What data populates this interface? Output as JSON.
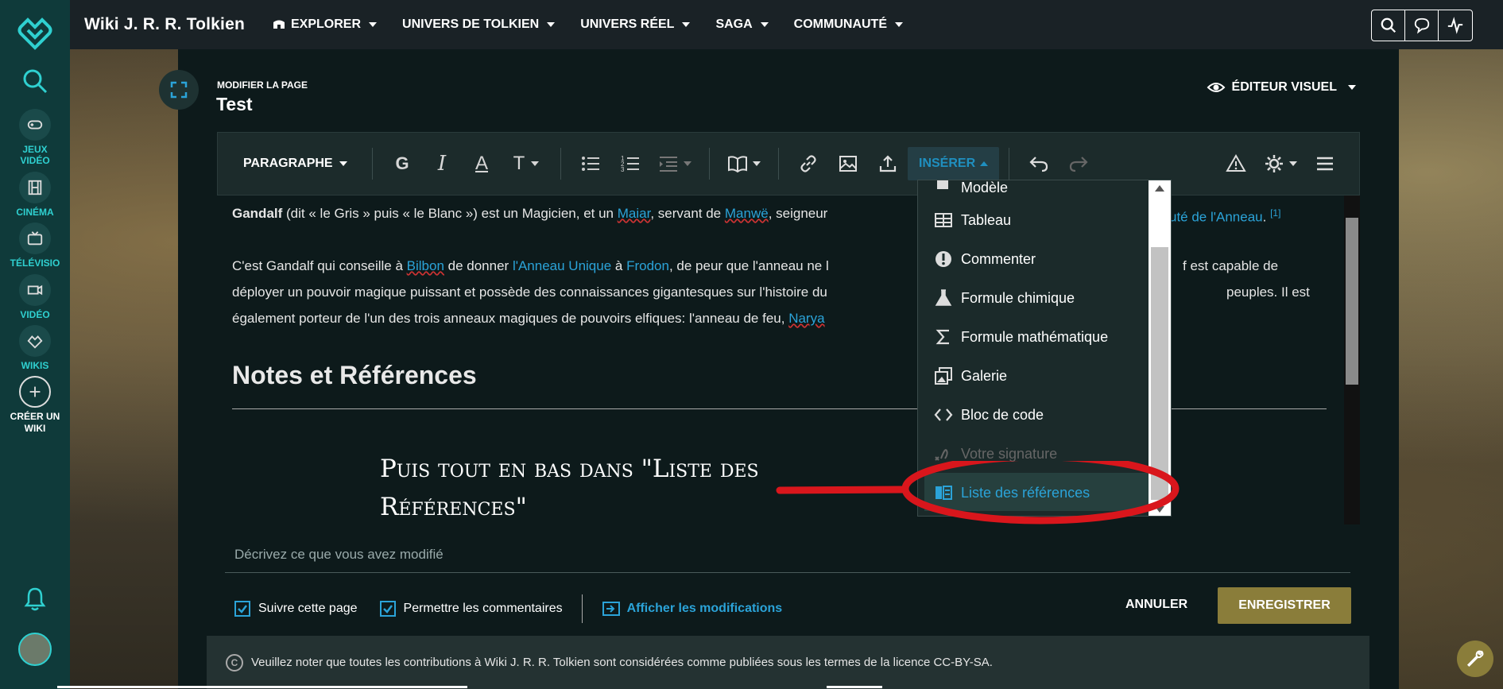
{
  "site": {
    "title": "Wiki J. R. R. Tolkien"
  },
  "nav": [
    {
      "label": "EXPLORER"
    },
    {
      "label": "UNIVERS DE TOLKIEN"
    },
    {
      "label": "UNIVERS RÉEL"
    },
    {
      "label": "SAGA"
    },
    {
      "label": "COMMUNAUTÉ"
    }
  ],
  "rail": {
    "games": "JEUX VIDÉO",
    "cinema": "CINÉMA",
    "tv": "TÉLÉVISIO",
    "video": "VIDÉO",
    "wikis": "WIKIS",
    "create": "CRÉER UN WIKI"
  },
  "editor": {
    "edit_label": "MODIFIER LA PAGE",
    "page_title": "Test",
    "mode": "ÉDITEUR VISUEL",
    "paragraph": "PARAGRAPHE",
    "insert": "INSÉRER",
    "bold": "G",
    "italic": "I",
    "color": "A",
    "text_style": "T"
  },
  "content": {
    "p1": {
      "bold": "Gandalf",
      "t1": " (dit « le Gris » puis « le Blanc ») est un Magicien, et un ",
      "l1": "Maiar",
      "t2": ", servant de ",
      "l2": "Manwë",
      "t3": ", seigneur",
      "l3": "uté de l'Anneau",
      "t4": ". ",
      "ref": "[1]"
    },
    "p2": {
      "t1": "C'est Gandalf qui conseille à ",
      "l1": "Bilbon",
      "t2": " de donner ",
      "l2": "l'Anneau Unique",
      "t3": " à ",
      "l3": "Frodon",
      "t4": ", de peur que l'anneau ne l",
      "t5": "f est capable de",
      "line2a": "déployer un pouvoir magique puissant et possède des connaissances gigantesques sur l'histoire du",
      "line2b": "peuples. Il est",
      "line3": "également porteur de l'un des trois anneaux magiques de pouvoirs elfiques: l'anneau de feu, ",
      "l4": "Narya"
    },
    "heading": "Notes et Références",
    "handnote": "Puis tout en bas dans \"Liste des Références\""
  },
  "insert_menu": {
    "items": [
      {
        "label": "Modèle",
        "icon": "puzzle-icon"
      },
      {
        "label": "Tableau",
        "icon": "table-icon"
      },
      {
        "label": "Commenter",
        "icon": "comment-icon"
      },
      {
        "label": "Formule chimique",
        "icon": "flask-icon"
      },
      {
        "label": "Formule mathématique",
        "icon": "sigma-icon"
      },
      {
        "label": "Galerie",
        "icon": "gallery-icon"
      },
      {
        "label": "Bloc de code",
        "icon": "code-icon"
      },
      {
        "label": "Votre signature",
        "icon": "signature-icon"
      },
      {
        "label": "Liste des références",
        "icon": "references-icon"
      }
    ]
  },
  "footer": {
    "summary_placeholder": "Décrivez ce que vous avez modifié",
    "watch": "Suivre cette page",
    "comments": "Permettre les commentaires",
    "show_changes": "Afficher les modifications",
    "cancel": "ANNULER",
    "save": "ENREGISTRER",
    "license": "Veuillez noter que toutes les contributions à Wiki J. R. R. Tolkien sont considérées comme publiées sous les termes de la licence CC-BY-SA.",
    "cc": "C"
  },
  "colors": {
    "rail_bg": "#0f3a3a",
    "accent": "#2ba3d8",
    "save_bg": "#8a7d3a",
    "annotation": "#d9161c"
  }
}
